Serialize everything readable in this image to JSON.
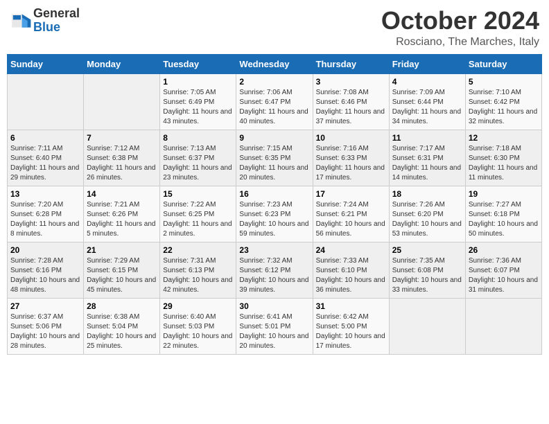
{
  "logo": {
    "line1": "General",
    "line2": "Blue"
  },
  "title": "October 2024",
  "subtitle": "Rosciano, The Marches, Italy",
  "days_of_week": [
    "Sunday",
    "Monday",
    "Tuesday",
    "Wednesday",
    "Thursday",
    "Friday",
    "Saturday"
  ],
  "weeks": [
    [
      {
        "day": "",
        "detail": ""
      },
      {
        "day": "",
        "detail": ""
      },
      {
        "day": "1",
        "detail": "Sunrise: 7:05 AM\nSunset: 6:49 PM\nDaylight: 11 hours and 43 minutes."
      },
      {
        "day": "2",
        "detail": "Sunrise: 7:06 AM\nSunset: 6:47 PM\nDaylight: 11 hours and 40 minutes."
      },
      {
        "day": "3",
        "detail": "Sunrise: 7:08 AM\nSunset: 6:46 PM\nDaylight: 11 hours and 37 minutes."
      },
      {
        "day": "4",
        "detail": "Sunrise: 7:09 AM\nSunset: 6:44 PM\nDaylight: 11 hours and 34 minutes."
      },
      {
        "day": "5",
        "detail": "Sunrise: 7:10 AM\nSunset: 6:42 PM\nDaylight: 11 hours and 32 minutes."
      }
    ],
    [
      {
        "day": "6",
        "detail": "Sunrise: 7:11 AM\nSunset: 6:40 PM\nDaylight: 11 hours and 29 minutes."
      },
      {
        "day": "7",
        "detail": "Sunrise: 7:12 AM\nSunset: 6:38 PM\nDaylight: 11 hours and 26 minutes."
      },
      {
        "day": "8",
        "detail": "Sunrise: 7:13 AM\nSunset: 6:37 PM\nDaylight: 11 hours and 23 minutes."
      },
      {
        "day": "9",
        "detail": "Sunrise: 7:15 AM\nSunset: 6:35 PM\nDaylight: 11 hours and 20 minutes."
      },
      {
        "day": "10",
        "detail": "Sunrise: 7:16 AM\nSunset: 6:33 PM\nDaylight: 11 hours and 17 minutes."
      },
      {
        "day": "11",
        "detail": "Sunrise: 7:17 AM\nSunset: 6:31 PM\nDaylight: 11 hours and 14 minutes."
      },
      {
        "day": "12",
        "detail": "Sunrise: 7:18 AM\nSunset: 6:30 PM\nDaylight: 11 hours and 11 minutes."
      }
    ],
    [
      {
        "day": "13",
        "detail": "Sunrise: 7:20 AM\nSunset: 6:28 PM\nDaylight: 11 hours and 8 minutes."
      },
      {
        "day": "14",
        "detail": "Sunrise: 7:21 AM\nSunset: 6:26 PM\nDaylight: 11 hours and 5 minutes."
      },
      {
        "day": "15",
        "detail": "Sunrise: 7:22 AM\nSunset: 6:25 PM\nDaylight: 11 hours and 2 minutes."
      },
      {
        "day": "16",
        "detail": "Sunrise: 7:23 AM\nSunset: 6:23 PM\nDaylight: 10 hours and 59 minutes."
      },
      {
        "day": "17",
        "detail": "Sunrise: 7:24 AM\nSunset: 6:21 PM\nDaylight: 10 hours and 56 minutes."
      },
      {
        "day": "18",
        "detail": "Sunrise: 7:26 AM\nSunset: 6:20 PM\nDaylight: 10 hours and 53 minutes."
      },
      {
        "day": "19",
        "detail": "Sunrise: 7:27 AM\nSunset: 6:18 PM\nDaylight: 10 hours and 50 minutes."
      }
    ],
    [
      {
        "day": "20",
        "detail": "Sunrise: 7:28 AM\nSunset: 6:16 PM\nDaylight: 10 hours and 48 minutes."
      },
      {
        "day": "21",
        "detail": "Sunrise: 7:29 AM\nSunset: 6:15 PM\nDaylight: 10 hours and 45 minutes."
      },
      {
        "day": "22",
        "detail": "Sunrise: 7:31 AM\nSunset: 6:13 PM\nDaylight: 10 hours and 42 minutes."
      },
      {
        "day": "23",
        "detail": "Sunrise: 7:32 AM\nSunset: 6:12 PM\nDaylight: 10 hours and 39 minutes."
      },
      {
        "day": "24",
        "detail": "Sunrise: 7:33 AM\nSunset: 6:10 PM\nDaylight: 10 hours and 36 minutes."
      },
      {
        "day": "25",
        "detail": "Sunrise: 7:35 AM\nSunset: 6:08 PM\nDaylight: 10 hours and 33 minutes."
      },
      {
        "day": "26",
        "detail": "Sunrise: 7:36 AM\nSunset: 6:07 PM\nDaylight: 10 hours and 31 minutes."
      }
    ],
    [
      {
        "day": "27",
        "detail": "Sunrise: 6:37 AM\nSunset: 5:06 PM\nDaylight: 10 hours and 28 minutes."
      },
      {
        "day": "28",
        "detail": "Sunrise: 6:38 AM\nSunset: 5:04 PM\nDaylight: 10 hours and 25 minutes."
      },
      {
        "day": "29",
        "detail": "Sunrise: 6:40 AM\nSunset: 5:03 PM\nDaylight: 10 hours and 22 minutes."
      },
      {
        "day": "30",
        "detail": "Sunrise: 6:41 AM\nSunset: 5:01 PM\nDaylight: 10 hours and 20 minutes."
      },
      {
        "day": "31",
        "detail": "Sunrise: 6:42 AM\nSunset: 5:00 PM\nDaylight: 10 hours and 17 minutes."
      },
      {
        "day": "",
        "detail": ""
      },
      {
        "day": "",
        "detail": ""
      }
    ]
  ]
}
